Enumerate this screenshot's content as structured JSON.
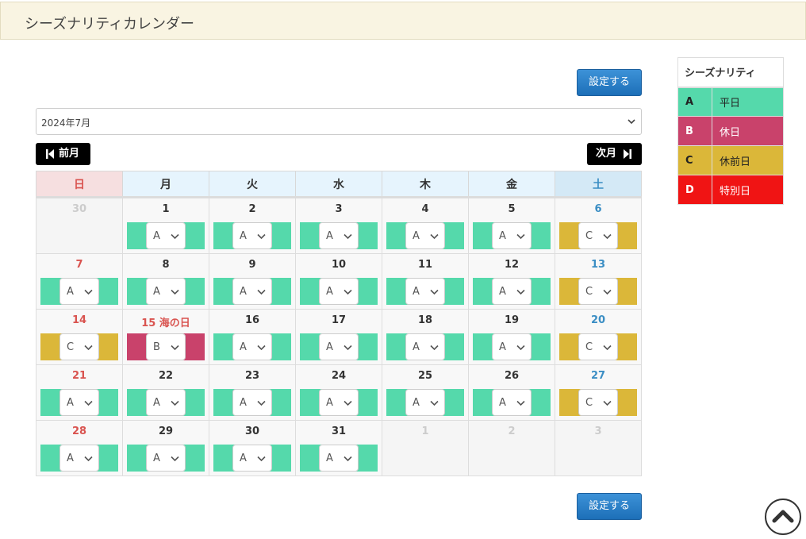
{
  "header": {
    "title": "シーズナリティカレンダー"
  },
  "buttons": {
    "save_top": "設定する",
    "save_bottom": "設定する"
  },
  "month_select": {
    "value": "2024年7月"
  },
  "nav": {
    "prev": "前月",
    "next": "次月"
  },
  "weekdays": [
    "日",
    "月",
    "火",
    "水",
    "木",
    "金",
    "土"
  ],
  "weeks": [
    [
      {
        "label": "30",
        "other": true
      },
      {
        "label": "1",
        "season": "A"
      },
      {
        "label": "2",
        "season": "A"
      },
      {
        "label": "3",
        "season": "A"
      },
      {
        "label": "4",
        "season": "A"
      },
      {
        "label": "5",
        "season": "A"
      },
      {
        "label": "6",
        "season": "C"
      }
    ],
    [
      {
        "label": "7",
        "season": "A"
      },
      {
        "label": "8",
        "season": "A"
      },
      {
        "label": "9",
        "season": "A"
      },
      {
        "label": "10",
        "season": "A"
      },
      {
        "label": "11",
        "season": "A"
      },
      {
        "label": "12",
        "season": "A"
      },
      {
        "label": "13",
        "season": "C"
      }
    ],
    [
      {
        "label": "14",
        "season": "C"
      },
      {
        "label": "15 海の日",
        "season": "B",
        "holiday": true
      },
      {
        "label": "16",
        "season": "A"
      },
      {
        "label": "17",
        "season": "A"
      },
      {
        "label": "18",
        "season": "A"
      },
      {
        "label": "19",
        "season": "A"
      },
      {
        "label": "20",
        "season": "C"
      }
    ],
    [
      {
        "label": "21",
        "season": "A"
      },
      {
        "label": "22",
        "season": "A"
      },
      {
        "label": "23",
        "season": "A"
      },
      {
        "label": "24",
        "season": "A"
      },
      {
        "label": "25",
        "season": "A"
      },
      {
        "label": "26",
        "season": "A"
      },
      {
        "label": "27",
        "season": "C"
      }
    ],
    [
      {
        "label": "28",
        "season": "A"
      },
      {
        "label": "29",
        "season": "A"
      },
      {
        "label": "30",
        "season": "A"
      },
      {
        "label": "31",
        "season": "A"
      },
      {
        "label": "1",
        "other": true
      },
      {
        "label": "2",
        "other": true
      },
      {
        "label": "3",
        "other": true
      }
    ]
  ],
  "legend": {
    "title": "シーズナリティ",
    "items": [
      {
        "code": "A",
        "label": "平日",
        "color": "#55d9ab"
      },
      {
        "code": "B",
        "label": "休日",
        "color": "#c9426b"
      },
      {
        "code": "C",
        "label": "休前日",
        "color": "#dbb739"
      },
      {
        "code": "D",
        "label": "特別日",
        "color": "#f01414"
      }
    ]
  },
  "icons": {
    "prev": "skip-back-icon",
    "next": "skip-forward-icon",
    "scroll_top": "chevron-up-icon"
  }
}
